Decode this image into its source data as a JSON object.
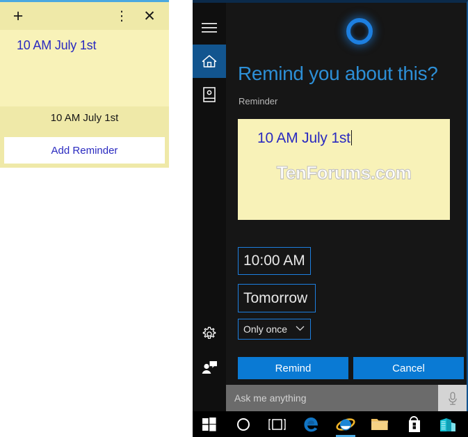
{
  "sticky_note": {
    "toolbar": {
      "add_label": "+",
      "add_icon": "plus-icon",
      "menu_label": "⋮",
      "menu_icon": "more-options-icon",
      "close_label": "✕",
      "close_icon": "close-icon"
    },
    "title": "10 AM July 1st",
    "suggestion": "10 AM July 1st",
    "add_reminder_label": "Add Reminder",
    "colors": {
      "paper": "#f8f2b8",
      "toolbar": "#efe9a8",
      "top_accent": "#4aa8e0",
      "title_text": "#2a2ac0"
    }
  },
  "cortana": {
    "rail": {
      "hamburger_icon": "hamburger-menu-icon",
      "home_icon": "home-icon",
      "notebook_icon": "notebook-icon",
      "settings_icon": "gear-icon",
      "feedback_icon": "feedback-icon"
    },
    "logo_icon": "cortana-ring-icon",
    "heading": "Remind you about this?",
    "subheading": "Reminder",
    "note": {
      "text": "10 AM July 1st",
      "watermark": "TenForums.com"
    },
    "fields": {
      "time": "10:00 AM",
      "day": "Tomorrow",
      "repeat": "Only once",
      "repeat_chevron": "⌄",
      "repeat_chevron_icon": "chevron-down-icon"
    },
    "buttons": {
      "remind": "Remind",
      "cancel": "Cancel"
    },
    "search": {
      "placeholder": "Ask me anything",
      "mic_icon": "microphone-icon"
    },
    "colors": {
      "accent": "#1d7fe0",
      "heading_text": "#2d8fd6",
      "button": "#0a7ad4",
      "panel_bg": "#161616",
      "rail_bg": "#0f0f0f"
    }
  },
  "taskbar": {
    "items": [
      {
        "name": "start-button",
        "icon": "windows-logo-icon"
      },
      {
        "name": "cortana-button",
        "icon": "cortana-circle-icon"
      },
      {
        "name": "task-view-button",
        "icon": "task-view-icon"
      },
      {
        "name": "edge-button",
        "icon": "edge-browser-icon"
      },
      {
        "name": "internet-explorer-button",
        "icon": "internet-explorer-icon"
      },
      {
        "name": "file-explorer-button",
        "icon": "file-explorer-icon"
      },
      {
        "name": "store-button",
        "icon": "microsoft-store-icon"
      },
      {
        "name": "server-app-button",
        "icon": "server-stack-icon"
      }
    ],
    "active_item": "internet-explorer-button"
  }
}
